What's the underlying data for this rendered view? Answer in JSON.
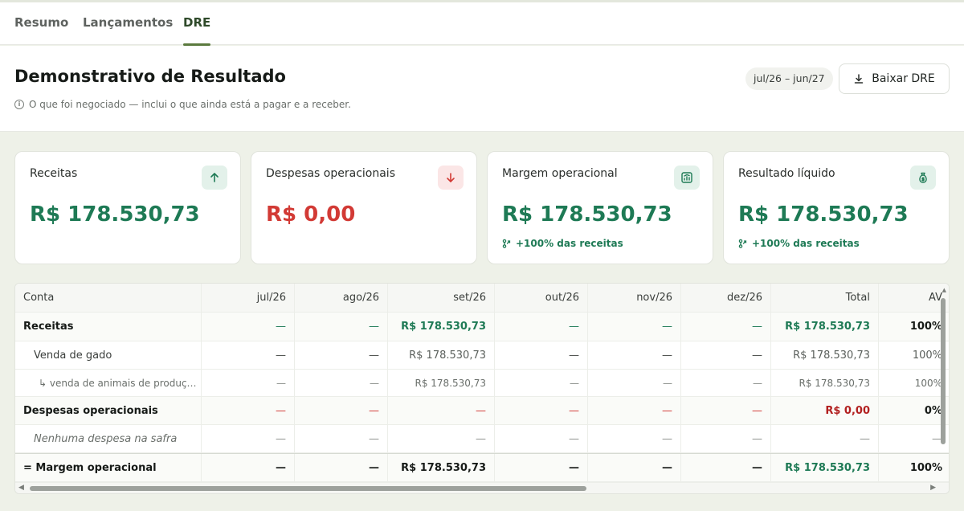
{
  "tabs": [
    {
      "label": "Resumo",
      "active": false
    },
    {
      "label": "Lançamentos",
      "active": false
    },
    {
      "label": "DRE",
      "active": true
    }
  ],
  "header": {
    "title": "Demonstrativo de Resultado",
    "subtitle": "O que foi negociado — inclui o que ainda está a pagar e a receber.",
    "period": "jul/26 – jun/27",
    "download_label": "Baixar DRE"
  },
  "cards": [
    {
      "label": "Receitas",
      "value": "R$ 178.530,73",
      "icon": "arrow-up-icon",
      "tone": "green",
      "note": ""
    },
    {
      "label": "Despesas operacionais",
      "value": "R$ 0,00",
      "icon": "arrow-down-icon",
      "tone": "red",
      "note": ""
    },
    {
      "label": "Margem operacional",
      "value": "R$ 178.530,73",
      "icon": "chart-icon",
      "tone": "green",
      "note": "+100% das receitas"
    },
    {
      "label": "Resultado líquido",
      "value": "R$ 178.530,73",
      "icon": "money-bag-icon",
      "tone": "green",
      "note": "+100% das receitas"
    }
  ],
  "table": {
    "columns": [
      "Conta",
      "jul/26",
      "ago/26",
      "set/26",
      "out/26",
      "nov/26",
      "dez/26",
      "Total",
      "AV"
    ],
    "rows": [
      {
        "cells": [
          "Receitas",
          "—",
          "—",
          "R$ 178.530,73",
          "—",
          "—",
          "—",
          "R$ 178.530,73",
          "100%"
        ]
      },
      {
        "cells": [
          "Venda de gado",
          "—",
          "—",
          "R$ 178.530,73",
          "—",
          "—",
          "—",
          "R$ 178.530,73",
          "100%"
        ]
      },
      {
        "cells": [
          "↳ venda de animais de produç…",
          "—",
          "—",
          "R$ 178.530,73",
          "—",
          "—",
          "—",
          "R$ 178.530,73",
          "100%"
        ]
      },
      {
        "cells": [
          "Despesas operacionais",
          "—",
          "—",
          "—",
          "—",
          "—",
          "—",
          "R$ 0,00",
          "0%"
        ]
      },
      {
        "cells": [
          "Nenhuma despesa na safra",
          "—",
          "—",
          "—",
          "—",
          "—",
          "—",
          "—",
          "—"
        ]
      },
      {
        "cells": [
          "= Margem operacional",
          "—",
          "—",
          "R$ 178.530,73",
          "—",
          "—",
          "—",
          "R$ 178.530,73",
          "100%"
        ]
      }
    ]
  },
  "colors": {
    "green": "#1e7a55",
    "red": "#d23a35",
    "accent": "#5b7a3e"
  }
}
